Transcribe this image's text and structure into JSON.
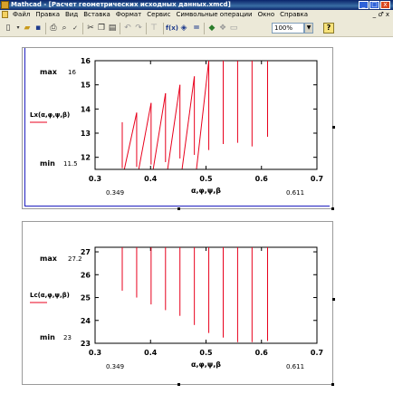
{
  "window": {
    "title": "Mathcad - [Расчет геометрических исходных данных.xmcd]",
    "min_label": "_",
    "max_label": "□",
    "close_label": "x",
    "title_color": "#0a246a"
  },
  "menu": {
    "items": [
      "Файл",
      "Правка",
      "Вид",
      "Вставка",
      "Формат",
      "Сервис",
      "Символьные операции",
      "Окно",
      "Справка"
    ],
    "mdi_controls": "_ ♂ x"
  },
  "toolbar": {
    "zoom_value": "100%",
    "buttons": [
      "new-icon",
      "open-icon",
      "save-icon",
      "print-icon",
      "print-preview-icon",
      "spell-check-icon",
      "cut-icon",
      "copy-icon",
      "paste-icon",
      "undo-icon",
      "redo-icon",
      "align-icon",
      "insert-function-icon",
      "insert-unit-icon",
      "calculate-icon",
      "component-icon",
      "resources-icon",
      "help-icon"
    ],
    "help_label": "?"
  },
  "plots": [
    {
      "chart_data": {
        "type": "line",
        "ylabel": "Lx(α,φ,ψ,β)",
        "xlabel": "α,φ,ψ,β",
        "xlim": [
          0.3,
          0.7
        ],
        "ylim": [
          11.5,
          16
        ],
        "xticks": [
          "0.3",
          "0.4",
          "0.5",
          "0.6",
          "0.7"
        ],
        "yticks": [
          "12",
          "13",
          "14",
          "15",
          "16"
        ],
        "ymax_label": "max",
        "ymax_value": "16",
        "ymin_label": "min",
        "ymin_value": "11.5",
        "xmin_value": "0.349",
        "xmax_value": "0.611",
        "series_color": "#e8001c",
        "x_positions": [
          0.349,
          0.375,
          0.401,
          0.427,
          0.453,
          0.479,
          0.505,
          0.531,
          0.557,
          0.583,
          0.611
        ],
        "segments_vertical": [
          {
            "x": 0.349,
            "y0": 11.55,
            "y1": 13.45
          },
          {
            "x": 0.375,
            "y0": 11.6,
            "y1": 13.85
          },
          {
            "x": 0.401,
            "y0": 11.7,
            "y1": 14.25
          },
          {
            "x": 0.427,
            "y0": 11.8,
            "y1": 14.65
          },
          {
            "x": 0.453,
            "y0": 11.95,
            "y1": 15.0
          },
          {
            "x": 0.479,
            "y0": 12.1,
            "y1": 15.35
          },
          {
            "x": 0.505,
            "y0": 12.3,
            "y1": 16.0
          },
          {
            "x": 0.531,
            "y0": 12.55,
            "y1": 16.0
          },
          {
            "x": 0.557,
            "y0": 12.6,
            "y1": 16.0
          },
          {
            "x": 0.583,
            "y0": 12.45,
            "y1": 16.0
          },
          {
            "x": 0.611,
            "y0": 12.85,
            "y1": 16.0
          }
        ]
      }
    },
    {
      "chart_data": {
        "type": "line",
        "ylabel": "Lc(α,φ,ψ,β)",
        "xlabel": "α,φ,ψ,β",
        "xlim": [
          0.3,
          0.7
        ],
        "ylim": [
          23,
          27.2
        ],
        "xticks": [
          "0.3",
          "0.4",
          "0.5",
          "0.6",
          "0.7"
        ],
        "yticks": [
          "23",
          "24",
          "25",
          "26",
          "27"
        ],
        "ymax_label": "max",
        "ymax_value": "27.2",
        "ymin_label": "min",
        "ymin_value": "23",
        "xmin_value": "0.349",
        "xmax_value": "0.611",
        "series_color": "#e8001c",
        "segments_vertical": [
          {
            "x": 0.349,
            "y0": 25.3,
            "y1": 27.2
          },
          {
            "x": 0.375,
            "y0": 25.0,
            "y1": 27.2
          },
          {
            "x": 0.401,
            "y0": 24.7,
            "y1": 27.2
          },
          {
            "x": 0.427,
            "y0": 24.45,
            "y1": 27.2
          },
          {
            "x": 0.453,
            "y0": 24.2,
            "y1": 27.2
          },
          {
            "x": 0.479,
            "y0": 23.8,
            "y1": 27.2
          },
          {
            "x": 0.505,
            "y0": 23.45,
            "y1": 27.2
          },
          {
            "x": 0.531,
            "y0": 23.25,
            "y1": 27.2
          },
          {
            "x": 0.557,
            "y0": 23.05,
            "y1": 27.2
          },
          {
            "x": 0.583,
            "y0": 23.05,
            "y1": 27.2
          },
          {
            "x": 0.611,
            "y0": 23.1,
            "y1": 27.2
          }
        ]
      }
    }
  ]
}
